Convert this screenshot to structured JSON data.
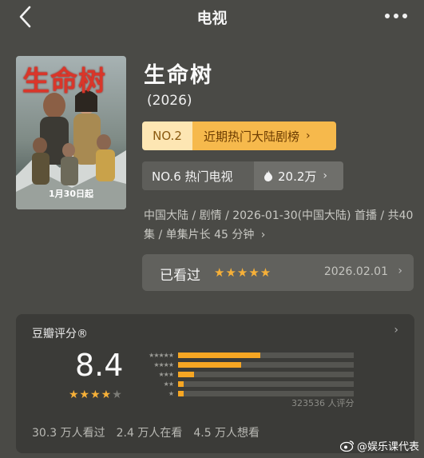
{
  "nav": {
    "title": "电视"
  },
  "poster": {
    "title_text": "生命树",
    "date_text": "1月30日起"
  },
  "movie": {
    "title": "生命树",
    "year": "(2026)"
  },
  "rank_primary": {
    "no": "NO.2",
    "label": "近期热门大陆剧榜"
  },
  "rank_secondary": {
    "no_label": "NO.6 热门电视",
    "heat": "20.2万"
  },
  "meta": {
    "text": "中国大陆 / 剧情 / 2026-01-30(中国大陆) 首播 / 共40集 / 单集片长 45 分钟"
  },
  "watched": {
    "label": "已看过",
    "stars": "★★★★★",
    "date": "2026.02.01"
  },
  "rating": {
    "header": "豆瓣评分®",
    "score": "8.4",
    "stars_on": "★★★★",
    "stars_off": "★",
    "count": "323536 人评分",
    "distribution": [
      {
        "stars": "★★★★★",
        "fraction": 0.47
      },
      {
        "stars": "★★★★",
        "fraction": 0.36
      },
      {
        "stars": "★★★",
        "fraction": 0.09
      },
      {
        "stars": "★★",
        "fraction": 0.03
      },
      {
        "stars": "★",
        "fraction": 0.03
      }
    ],
    "stats": [
      "30.3 万人看过",
      "2.4 万人在看",
      "4.5 万人想看"
    ]
  },
  "watermark": {
    "text": "@娱乐课代表"
  },
  "colors": {
    "accent": "#f6b038",
    "rank_bg": "#f6b94c",
    "page_bg": "#4a4a46"
  },
  "icons": [
    "back-icon",
    "more-icon",
    "chevron-right-icon",
    "flame-icon",
    "weibo-icon"
  ]
}
